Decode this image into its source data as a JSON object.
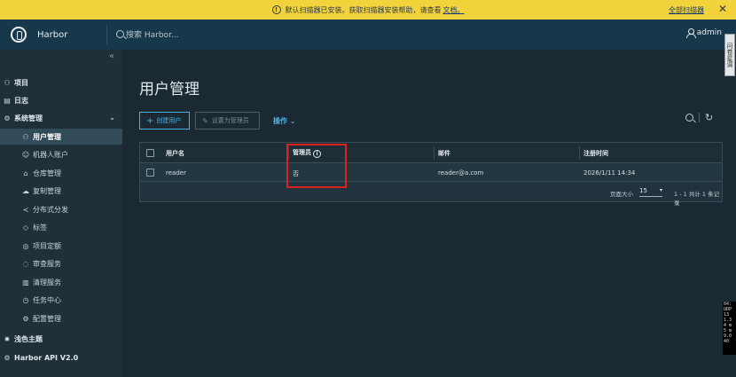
{
  "banner": {
    "message": "默认扫描器已安装。获取扫描器安装帮助，请查看",
    "doc_link": "文档。",
    "right_link": "全部扫描器",
    "close": "✕"
  },
  "header": {
    "brand": "Harbor",
    "search_placeholder": "搜索 Harbor...",
    "user": "admin",
    "side_tab": "问卷星调"
  },
  "sidebar": {
    "collapse": "«",
    "items": [
      {
        "label": "项目",
        "icon": "projects-icon"
      },
      {
        "label": "日志",
        "icon": "logs-icon"
      },
      {
        "label": "系统管理",
        "icon": "admin-icon"
      },
      {
        "label": "用户管理",
        "icon": "users-icon"
      },
      {
        "label": "机器人账户",
        "icon": "robot-icon"
      },
      {
        "label": "仓库管理",
        "icon": "registry-icon"
      },
      {
        "label": "复制管理",
        "icon": "replication-icon"
      },
      {
        "label": "分布式分发",
        "icon": "distribution-icon"
      },
      {
        "label": "标签",
        "icon": "tag-icon"
      },
      {
        "label": "项目定额",
        "icon": "quota-icon"
      },
      {
        "label": "审查服务",
        "icon": "shield-icon"
      },
      {
        "label": "清理服务",
        "icon": "trash-icon"
      },
      {
        "label": "任务中心",
        "icon": "clock-icon"
      },
      {
        "label": "配置管理",
        "icon": "gear-icon"
      },
      {
        "label": "浅色主题",
        "icon": "sun-icon"
      },
      {
        "label": "Harbor API V2.0",
        "icon": "api-icon"
      }
    ]
  },
  "main": {
    "title": "用户管理",
    "create_button": "创建用户",
    "set_admin_button": "设置为管理员",
    "ops": "操作",
    "columns": [
      "用户名",
      "管理员",
      "邮件",
      "注册时间"
    ],
    "rows": [
      {
        "username": "reader",
        "admin": "否",
        "email": "reader@a.com",
        "registered": "2026/1/11 14:34"
      }
    ],
    "page_size_label": "页面大小",
    "page_size": "15",
    "page_info": "1 - 1 共计 1 条记录"
  },
  "terminal": {
    "lines": [
      "04:",
      "UDP",
      "13",
      "1.3",
      "4 m",
      "5 m",
      "9.0",
      "40"
    ]
  },
  "colors": {
    "accent": "#49b3e8",
    "banner": "#f2d33b",
    "header": "#17384a",
    "highlight": "#e02020"
  }
}
